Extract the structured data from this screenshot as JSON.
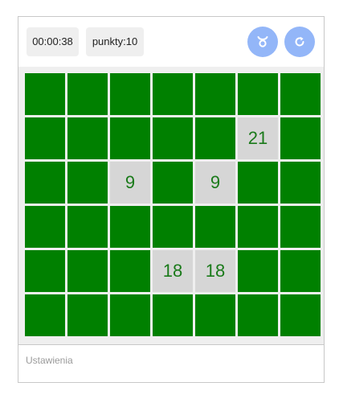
{
  "header": {
    "timer": "00:00:38",
    "score": "punkty:10",
    "buttons": [
      {
        "icon": "taurus-icon",
        "glyph": "♉"
      },
      {
        "icon": "restart-icon"
      }
    ]
  },
  "board": {
    "rows": 6,
    "cols": 7,
    "closed_color": "#008000",
    "open_color": "#d6d6d6",
    "number_color": "#1a7a1a",
    "cells": [
      [
        "",
        "",
        "",
        "",
        "",
        "",
        ""
      ],
      [
        "",
        "",
        "",
        "",
        "",
        "21",
        ""
      ],
      [
        "",
        "",
        "9",
        "",
        "9",
        "",
        ""
      ],
      [
        "",
        "",
        "",
        "",
        "",
        "",
        ""
      ],
      [
        "",
        "",
        "",
        "18",
        "18",
        "",
        ""
      ],
      [
        "",
        "",
        "",
        "",
        "",
        "",
        ""
      ]
    ]
  },
  "footer": {
    "settings_link": "Ustawienia"
  }
}
